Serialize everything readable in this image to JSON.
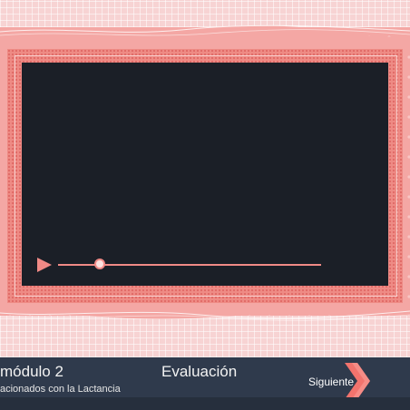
{
  "colors": {
    "accent": "#f08a86",
    "video_bg": "#1b1f27",
    "footer_bg": "#2f3a4c"
  },
  "player": {
    "play_icon": "play-icon",
    "progress_fraction": 0.16
  },
  "footer": {
    "title": "módulo 2",
    "subtitle": "acionados con la Lactancia",
    "evaluation_label": "Evaluación",
    "next_label": "Siguiente",
    "next_icon": "chevron-right-icon"
  }
}
